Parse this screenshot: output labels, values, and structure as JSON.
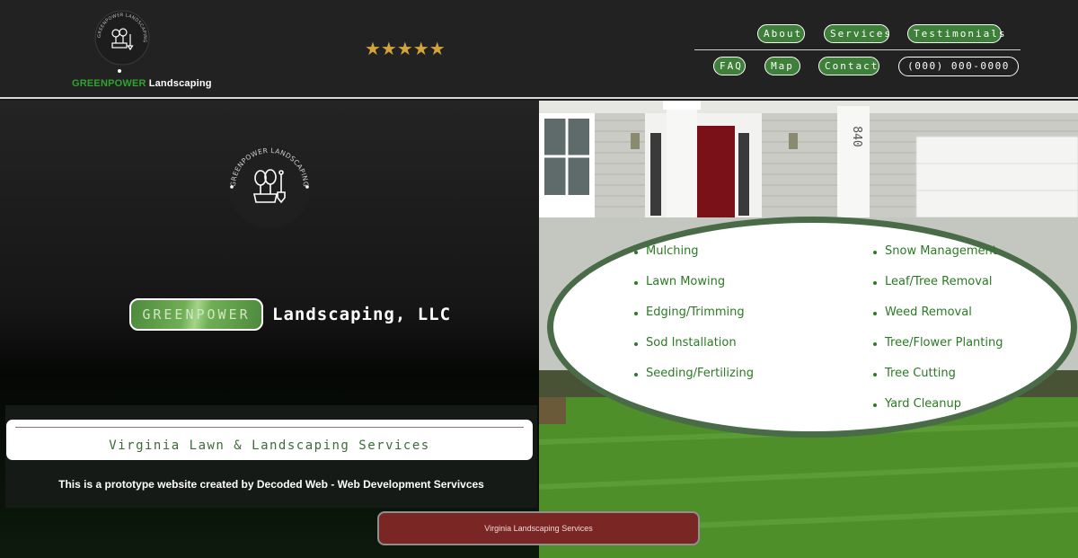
{
  "header": {
    "brand_green": "GREENPOWER",
    "brand_white": "Landscaping",
    "logo_ring_text": "GREENPOWER LANDSCAPING",
    "rating_stars": "★★★★★",
    "nav_top": [
      "About",
      "Services",
      "Testimonials"
    ],
    "nav_bottom": [
      "FAQ",
      "Map",
      "Contact"
    ],
    "phone": "(000) 000-0000"
  },
  "hero": {
    "logo_ring_text": "GREENPOWER LANDSCAPING",
    "title_green": "GREENPOWER",
    "title_rest": "Landscaping, LLC",
    "subtitle": "Virginia Lawn & Landscaping Services",
    "prototype_note": "This is a prototype website created by Decoded Web - Web Development Servivces"
  },
  "photo": {
    "house_number": "840"
  },
  "services": {
    "left": [
      "Mulching",
      "Lawn Mowing",
      "Edging/Trimming",
      "Sod Installation",
      "Seeding/Fertilizing"
    ],
    "right": [
      "Snow Management",
      "Leaf/Tree Removal",
      "Weed Removal",
      "Tree/Flower Planting",
      "Tree Cutting",
      "Yard Cleanup"
    ]
  },
  "cta": {
    "label": "Virginia Landscaping Services"
  },
  "colors": {
    "header_bg": "#222222",
    "brand_green": "#2fa32f",
    "nav_green": "#3e7f3a",
    "star_gold": "#d1a43c",
    "service_text": "#2b7a24",
    "cta_red": "#7a2625"
  }
}
